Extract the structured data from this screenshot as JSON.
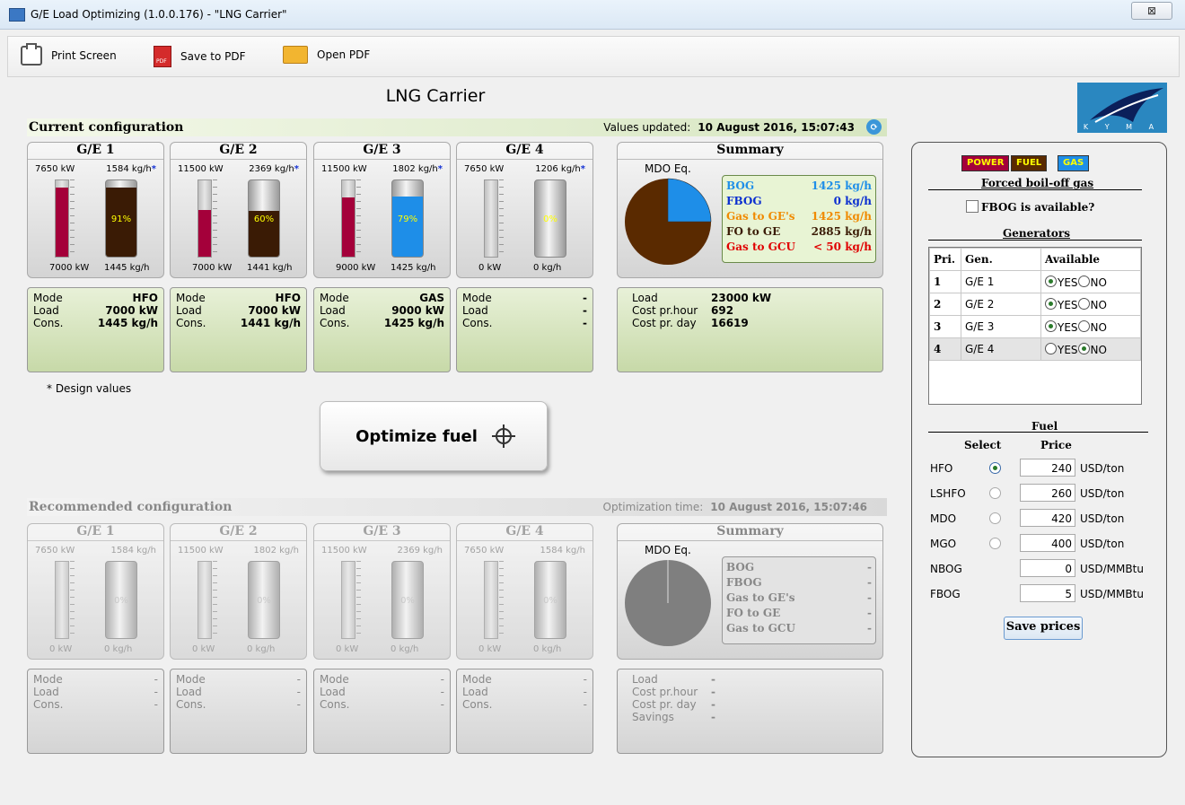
{
  "window": {
    "title": "G/E Load Optimizing (1.0.0.176) - \"LNG Carrier\"",
    "close_label": "⊠"
  },
  "toolbar": {
    "print_label": "Print Screen",
    "save_pdf_label": "Save to PDF",
    "open_pdf_label": "Open PDF"
  },
  "page": {
    "title": "LNG Carrier",
    "logo_text": "K Y M A"
  },
  "current": {
    "label": "Current configuration",
    "updated_label": "Values updated:",
    "updated_value": "10 August 2016, 15:07:43",
    "engines": [
      {
        "name": "G/E 1",
        "kw_top": "7650 kW",
        "kg_top": "1584 kg/h",
        "kw_bot": "7000 kW",
        "kg_bot": "1445 kg/h",
        "power_level": 0.91,
        "fuel_level": 0.91,
        "fuel_pct": "91%",
        "fuel_color": "#3a1b05",
        "mode": "HFO",
        "load": "7000 kW",
        "cons": "1445 kg/h"
      },
      {
        "name": "G/E 2",
        "kw_top": "11500 kW",
        "kg_top": "2369 kg/h",
        "kw_bot": "7000 kW",
        "kg_bot": "1441 kg/h",
        "power_level": 0.61,
        "fuel_level": 0.6,
        "fuel_pct": "60%",
        "fuel_color": "#3a1b05",
        "mode": "HFO",
        "load": "7000 kW",
        "cons": "1441 kg/h"
      },
      {
        "name": "G/E 3",
        "kw_top": "11500 kW",
        "kg_top": "1802 kg/h",
        "kw_bot": "9000 kW",
        "kg_bot": "1425 kg/h",
        "power_level": 0.78,
        "fuel_level": 0.79,
        "fuel_pct": "79%",
        "fuel_color": "#1e8ee8",
        "mode": "GAS",
        "load": "9000 kW",
        "cons": "1425 kg/h"
      },
      {
        "name": "G/E 4",
        "kw_top": "7650 kW",
        "kg_top": "1206 kg/h",
        "kw_bot": "0 kW",
        "kg_bot": "0 kg/h",
        "power_level": 0,
        "fuel_level": 0,
        "fuel_pct": "0%",
        "fuel_color": "#3a1b05",
        "mode": "-",
        "load": "-",
        "cons": "-"
      }
    ],
    "summary": {
      "title": "Summary",
      "mdo_label": "MDO Eq.",
      "pie": {
        "fuel_share": 0.75,
        "gas_share": 0.25
      },
      "legend": [
        {
          "label": "BOG",
          "value": "1425 kg/h",
          "color": "#1e8ee8"
        },
        {
          "label": "FBOG",
          "value": "0 kg/h",
          "color": "#0b2fd0"
        },
        {
          "label": "Gas to GE's",
          "value": "1425 kg/h",
          "color": "#f08a00"
        },
        {
          "label": "FO to GE",
          "value": "2885 kg/h",
          "color": "#3a1b05"
        },
        {
          "label": "Gas to GCU",
          "value": "< 50 kg/h",
          "color": "#e00000"
        }
      ],
      "info": [
        {
          "label": "Load",
          "value": "23000 kW"
        },
        {
          "label": "Cost pr.hour",
          "value": "692"
        },
        {
          "label": "Cost pr. day",
          "value": "16619"
        }
      ]
    }
  },
  "labels": {
    "mode": "Mode",
    "load": "Load",
    "cons": "Cons.",
    "design_note": "* Design values",
    "optimize": "Optimize fuel"
  },
  "recommended": {
    "label": "Recommended configuration",
    "time_label": "Optimization time:",
    "time_value": "10 August 2016, 15:07:46",
    "engines": [
      {
        "name": "G/E 1",
        "kw_top": "7650 kW",
        "kg_top": "1584 kg/h",
        "kw_bot": "0 kW",
        "kg_bot": "0 kg/h",
        "fuel_pct": "0%",
        "mode": "-",
        "load": "-",
        "cons": "-"
      },
      {
        "name": "G/E 2",
        "kw_top": "11500 kW",
        "kg_top": "1802 kg/h",
        "kw_bot": "0 kW",
        "kg_bot": "0 kg/h",
        "fuel_pct": "0%",
        "mode": "-",
        "load": "-",
        "cons": "-"
      },
      {
        "name": "G/E 3",
        "kw_top": "11500 kW",
        "kg_top": "2369 kg/h",
        "kw_bot": "0 kW",
        "kg_bot": "0 kg/h",
        "fuel_pct": "0%",
        "mode": "-",
        "load": "-",
        "cons": "-"
      },
      {
        "name": "G/E 4",
        "kw_top": "7650 kW",
        "kg_top": "1584 kg/h",
        "kw_bot": "0 kW",
        "kg_bot": "0 kg/h",
        "fuel_pct": "0%",
        "mode": "-",
        "load": "-",
        "cons": "-"
      }
    ],
    "summary": {
      "title": "Summary",
      "mdo_label": "MDO Eq.",
      "legend": [
        {
          "label": "BOG",
          "value": "-"
        },
        {
          "label": "FBOG",
          "value": "-"
        },
        {
          "label": "Gas to GE's",
          "value": "-"
        },
        {
          "label": "FO to GE",
          "value": "-"
        },
        {
          "label": "Gas to GCU",
          "value": "-"
        }
      ],
      "info": [
        {
          "label": "Load",
          "value": "-"
        },
        {
          "label": "Cost pr.hour",
          "value": "-"
        },
        {
          "label": "Cost pr. day",
          "value": "-"
        },
        {
          "label": "Savings",
          "value": "-"
        }
      ]
    }
  },
  "right": {
    "chips": [
      {
        "label": "POWER",
        "bg": "#a4003a",
        "fg": "#ffff00"
      },
      {
        "label": "FUEL",
        "bg": "#5a2a00",
        "fg": "#ffff00"
      },
      {
        "label": "GAS",
        "bg": "#1e8ee8",
        "fg": "#ffff00"
      }
    ],
    "forced_title": "Forced boil-off gas",
    "fbog_checkbox": "FBOG is available?",
    "generators_title": "Generators",
    "gen_headers": [
      "Pri.",
      "Gen.",
      "Available"
    ],
    "generators": [
      {
        "pri": "1",
        "gen": "G/E 1",
        "available": "YES"
      },
      {
        "pri": "2",
        "gen": "G/E 2",
        "available": "YES"
      },
      {
        "pri": "3",
        "gen": "G/E 3",
        "available": "YES"
      },
      {
        "pri": "4",
        "gen": "G/E 4",
        "available": "NO"
      }
    ],
    "yes_label": "YES",
    "no_label": "NO",
    "fuel_title": "Fuel",
    "select_header": "Select",
    "price_header": "Price",
    "fuels": [
      {
        "name": "HFO",
        "selected": true,
        "price": "240",
        "unit": "USD/ton"
      },
      {
        "name": "LSHFO",
        "selected": false,
        "price": "260",
        "unit": "USD/ton"
      },
      {
        "name": "MDO",
        "selected": false,
        "price": "420",
        "unit": "USD/ton"
      },
      {
        "name": "MGO",
        "selected": false,
        "price": "400",
        "unit": "USD/ton"
      },
      {
        "name": "NBOG",
        "selected": null,
        "price": "0",
        "unit": "USD/MMBtu"
      },
      {
        "name": "FBOG",
        "selected": null,
        "price": "5",
        "unit": "USD/MMBtu"
      }
    ],
    "save_label": "Save prices"
  }
}
